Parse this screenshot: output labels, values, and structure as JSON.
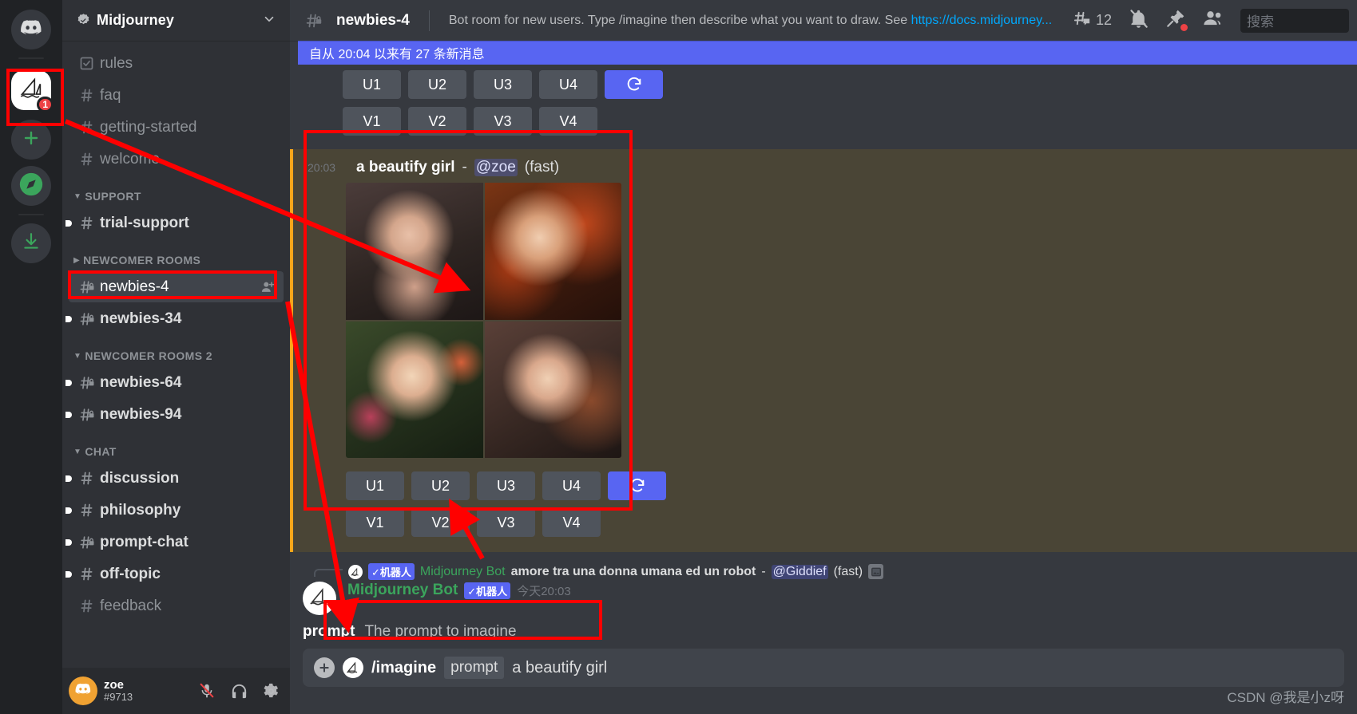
{
  "server_rail": {
    "items": [
      {
        "name": "discord-home",
        "icon": "discord-logo-icon",
        "label": "Discord"
      },
      {
        "name": "midjourney-server",
        "icon": "sailboat-icon",
        "label": "Midjourney",
        "badge": "1",
        "selected": true
      },
      {
        "name": "add-server",
        "icon": "plus-icon",
        "label": "Add a Server"
      },
      {
        "name": "explore-servers",
        "icon": "compass-icon",
        "label": "Explore Public Servers"
      },
      {
        "name": "download-apps",
        "icon": "download-icon",
        "label": "Download Apps"
      }
    ]
  },
  "sidebar": {
    "guild_name": "Midjourney",
    "verified_icon": "verified-check-icon",
    "collapse_icon": "chevron-down-icon",
    "channels": [
      {
        "label": "rules",
        "icon": "rules-icon",
        "state": "read"
      },
      {
        "label": "faq",
        "icon": "hash-icon",
        "state": "read"
      },
      {
        "label": "getting-started",
        "icon": "hash-icon",
        "state": "read"
      },
      {
        "label": "welcome",
        "icon": "hash-icon",
        "state": "read"
      }
    ],
    "categories": [
      {
        "label": "SUPPORT",
        "expanded": true,
        "channels": [
          {
            "label": "trial-support",
            "icon": "hash-icon",
            "state": "unread"
          }
        ]
      },
      {
        "label": "NEWCOMER ROOMS",
        "expanded": false,
        "channels": [
          {
            "label": "newbies-4",
            "icon": "hash-lock-icon",
            "state": "active",
            "tail_icon": "add-member-icon"
          },
          {
            "label": "newbies-34",
            "icon": "hash-lock-icon",
            "state": "unread"
          }
        ]
      },
      {
        "label": "NEWCOMER ROOMS 2",
        "expanded": true,
        "channels": [
          {
            "label": "newbies-64",
            "icon": "hash-lock-icon",
            "state": "unread"
          },
          {
            "label": "newbies-94",
            "icon": "hash-lock-icon",
            "state": "unread"
          }
        ]
      },
      {
        "label": "CHAT",
        "expanded": true,
        "channels": [
          {
            "label": "discussion",
            "icon": "hash-icon",
            "state": "unread"
          },
          {
            "label": "philosophy",
            "icon": "hash-icon",
            "state": "unread"
          },
          {
            "label": "prompt-chat",
            "icon": "hash-lock-icon",
            "state": "unread"
          },
          {
            "label": "off-topic",
            "icon": "hash-icon",
            "state": "unread"
          },
          {
            "label": "feedback",
            "icon": "hash-icon",
            "state": "read"
          }
        ]
      }
    ],
    "user_panel": {
      "name": "zoe",
      "discriminator": "#9713",
      "avatar_icon": "discord-avatar-icon",
      "mic_icon": "mic-muted-icon",
      "headphone_icon": "headphones-icon",
      "settings_icon": "gear-icon"
    }
  },
  "topbar": {
    "hash_icon": "hash-lock-icon",
    "channel_name": "newbies-4",
    "topic_prefix": "Bot room for new users. Type /imagine then describe what you want to draw. See ",
    "topic_link": "https://docs.midjourney...",
    "threads_icon": "threads-icon",
    "threads_count": "12",
    "notifications_icon": "bell-off-icon",
    "pinned_icon": "pin-icon",
    "members_icon": "members-icon",
    "search_placeholder": "搜索",
    "search_value": ""
  },
  "unread_banner": {
    "text": "自从 20:04 以来有 27 条新消息"
  },
  "messages": {
    "top_buttons": {
      "upscale": [
        "U1",
        "U2",
        "U3",
        "U4"
      ],
      "variation": [
        "V1",
        "V2",
        "V3",
        "V4"
      ],
      "refresh_icon": "refresh-icon"
    },
    "highlighted_message": {
      "timestamp": "20:03",
      "prompt": "a beautify girl",
      "dash": "-",
      "mention": "@zoe",
      "mode": "(fast)",
      "image_grid_alt": "four generated portraits of a girl",
      "upscale": [
        "U1",
        "U2",
        "U3",
        "U4"
      ],
      "variation": [
        "V1",
        "V2",
        "V3",
        "V4"
      ],
      "refresh_icon": "refresh-icon"
    },
    "reply_context": {
      "bot_avatar_icon": "sailboat-icon",
      "bot_tag": "✓机器人",
      "bot_name": "Midjourney Bot",
      "text": "amore tra una donna umana ed un robot",
      "dash": "-",
      "mention": "@Giddief",
      "mode": "(fast)",
      "attachment_icon": "image-icon"
    },
    "command_message": {
      "avatar_icon": "sailboat-icon",
      "name": "Midjourney Bot",
      "bot_tag": "✓机器人",
      "timestamp": "今天20:03",
      "param_name": "prompt",
      "param_description": "The prompt to imagine"
    }
  },
  "composer": {
    "plus_icon": "plus-circle-icon",
    "avatar_icon": "sailboat-icon",
    "command": "/imagine",
    "param_chip": "prompt",
    "value": "a beautify girl"
  },
  "watermark": {
    "text": "CSDN @我是小z呀"
  },
  "colors": {
    "accent": "#5865f2",
    "annotation": "#ff0000",
    "bot_green": "#3ba55c",
    "badge_red": "#ed4245"
  }
}
